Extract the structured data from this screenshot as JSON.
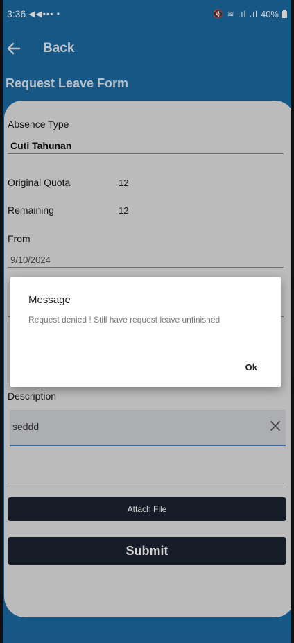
{
  "status_bar": {
    "time": "3:36",
    "left_icons": "◀◀▪▪▪ •",
    "right_icons": "🔇 ≋ .ıl .ıl",
    "battery": "40%"
  },
  "app_bar": {
    "back_label": "Back"
  },
  "form": {
    "title": "Request Leave Form",
    "absence_type_label": "Absence Type",
    "absence_type_value": "Cuti Tahunan",
    "original_quota_label": "Original Quota",
    "original_quota_value": "12",
    "remaining_label": "Remaining",
    "remaining_value": "12",
    "from_label": "From",
    "from_value": "9/10/2024",
    "description_label": "Description",
    "description_value": "seddd",
    "attach_label": "Attach File",
    "submit_label": "Submit"
  },
  "dialog": {
    "title": "Message",
    "message": "Request denied ! Still have request leave unfinished",
    "ok_label": "Ok"
  },
  "colors": {
    "header_blue": "#1d6ba4",
    "card_bg": "#e4e4e4",
    "button_dark": "#1b2433",
    "input_underline": "#4a7fc1"
  },
  "icons": {
    "back": "arrow-left-icon",
    "clear": "close-icon"
  }
}
